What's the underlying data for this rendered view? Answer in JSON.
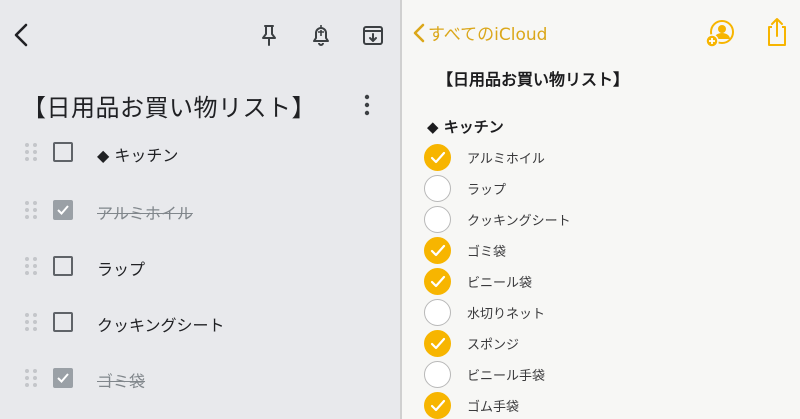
{
  "colors": {
    "keep_bg": "#e8e9ec",
    "notes_accent": "#f7b500",
    "notes_link": "#dba71a"
  },
  "keep": {
    "title": "【日用品お買い物リスト】",
    "icons": [
      "back-arrow-icon",
      "pin-icon",
      "reminder-bell-icon",
      "archive-icon",
      "more-vert-icon"
    ],
    "items": [
      {
        "label": "◆ キッチン",
        "checked": false
      },
      {
        "label": "アルミホイル",
        "checked": true
      },
      {
        "label": "ラップ",
        "checked": false
      },
      {
        "label": "クッキングシート",
        "checked": false
      },
      {
        "label": "ゴミ袋",
        "checked": true
      }
    ]
  },
  "notes": {
    "back_label": "すべてのiCloud",
    "title": "【日用品お買い物リスト】",
    "heading": "◆ キッチン",
    "icons": [
      "add-person-icon",
      "share-icon"
    ],
    "items": [
      {
        "label": "アルミホイル",
        "checked": true
      },
      {
        "label": "ラップ",
        "checked": false
      },
      {
        "label": "クッキングシート",
        "checked": false
      },
      {
        "label": "ゴミ袋",
        "checked": true
      },
      {
        "label": "ビニール袋",
        "checked": true
      },
      {
        "label": "水切りネット",
        "checked": false
      },
      {
        "label": "スポンジ",
        "checked": true
      },
      {
        "label": "ビニール手袋",
        "checked": false
      },
      {
        "label": "ゴム手袋",
        "checked": true
      }
    ]
  }
}
